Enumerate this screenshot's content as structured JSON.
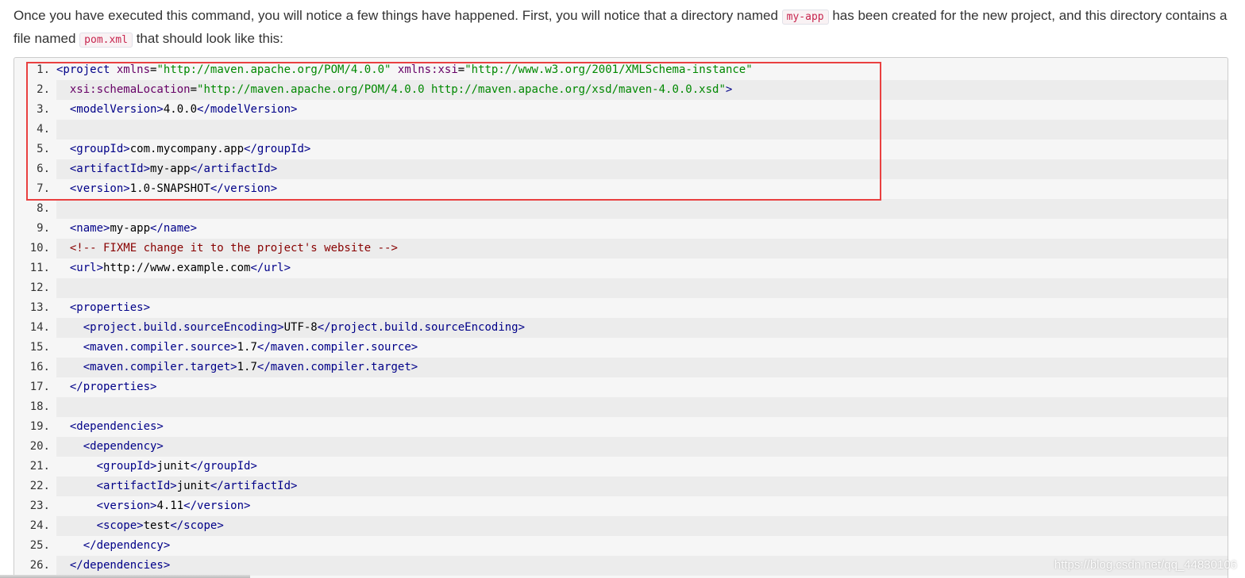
{
  "intro": {
    "part1": "Once you have executed this command, you will notice a few things have happened. First, you will notice that a directory named ",
    "code1": "my-app",
    "part2": " has been created for the new project, and this directory contains a file named ",
    "code2": "pom.xml",
    "part3": " that should look like this:"
  },
  "code": {
    "lines": [
      {
        "n": "1.",
        "tokens": [
          [
            "tag",
            "<project"
          ],
          [
            "pln",
            " "
          ],
          [
            "attr",
            "xmlns"
          ],
          [
            "pln",
            "="
          ],
          [
            "str",
            "\"http://maven.apache.org/POM/4.0.0\""
          ],
          [
            "pln",
            " "
          ],
          [
            "attr",
            "xmlns:xsi"
          ],
          [
            "pln",
            "="
          ],
          [
            "str",
            "\"http://www.w3.org/2001/XMLSchema-instance\""
          ]
        ]
      },
      {
        "n": "2.",
        "tokens": [
          [
            "pln",
            "  "
          ],
          [
            "attr",
            "xsi:schemaLocation"
          ],
          [
            "pln",
            "="
          ],
          [
            "str",
            "\"http://maven.apache.org/POM/4.0.0 http://maven.apache.org/xsd/maven-4.0.0.xsd\""
          ],
          [
            "tag",
            ">"
          ]
        ]
      },
      {
        "n": "3.",
        "tokens": [
          [
            "pln",
            "  "
          ],
          [
            "tag",
            "<modelVersion>"
          ],
          [
            "pln",
            "4.0.0"
          ],
          [
            "tag",
            "</modelVersion>"
          ]
        ]
      },
      {
        "n": "4.",
        "tokens": []
      },
      {
        "n": "5.",
        "tokens": [
          [
            "pln",
            "  "
          ],
          [
            "tag",
            "<groupId>"
          ],
          [
            "pln",
            "com.mycompany.app"
          ],
          [
            "tag",
            "</groupId>"
          ]
        ]
      },
      {
        "n": "6.",
        "tokens": [
          [
            "pln",
            "  "
          ],
          [
            "tag",
            "<artifactId>"
          ],
          [
            "pln",
            "my-app"
          ],
          [
            "tag",
            "</artifactId>"
          ]
        ]
      },
      {
        "n": "7.",
        "tokens": [
          [
            "pln",
            "  "
          ],
          [
            "tag",
            "<version>"
          ],
          [
            "pln",
            "1.0-SNAPSHOT"
          ],
          [
            "tag",
            "</version>"
          ]
        ]
      },
      {
        "n": "8.",
        "tokens": []
      },
      {
        "n": "9.",
        "tokens": [
          [
            "pln",
            "  "
          ],
          [
            "tag",
            "<name>"
          ],
          [
            "pln",
            "my-app"
          ],
          [
            "tag",
            "</name>"
          ]
        ]
      },
      {
        "n": "10.",
        "tokens": [
          [
            "pln",
            "  "
          ],
          [
            "com",
            "<!-- FIXME change it to the project's website -->"
          ]
        ]
      },
      {
        "n": "11.",
        "tokens": [
          [
            "pln",
            "  "
          ],
          [
            "tag",
            "<url>"
          ],
          [
            "pln",
            "http://www.example.com"
          ],
          [
            "tag",
            "</url>"
          ]
        ]
      },
      {
        "n": "12.",
        "tokens": []
      },
      {
        "n": "13.",
        "tokens": [
          [
            "pln",
            "  "
          ],
          [
            "tag",
            "<properties>"
          ]
        ]
      },
      {
        "n": "14.",
        "tokens": [
          [
            "pln",
            "    "
          ],
          [
            "tag",
            "<project.build.sourceEncoding>"
          ],
          [
            "pln",
            "UTF-8"
          ],
          [
            "tag",
            "</project.build.sourceEncoding>"
          ]
        ]
      },
      {
        "n": "15.",
        "tokens": [
          [
            "pln",
            "    "
          ],
          [
            "tag",
            "<maven.compiler.source>"
          ],
          [
            "pln",
            "1.7"
          ],
          [
            "tag",
            "</maven.compiler.source>"
          ]
        ]
      },
      {
        "n": "16.",
        "tokens": [
          [
            "pln",
            "    "
          ],
          [
            "tag",
            "<maven.compiler.target>"
          ],
          [
            "pln",
            "1.7"
          ],
          [
            "tag",
            "</maven.compiler.target>"
          ]
        ]
      },
      {
        "n": "17.",
        "tokens": [
          [
            "pln",
            "  "
          ],
          [
            "tag",
            "</properties>"
          ]
        ]
      },
      {
        "n": "18.",
        "tokens": []
      },
      {
        "n": "19.",
        "tokens": [
          [
            "pln",
            "  "
          ],
          [
            "tag",
            "<dependencies>"
          ]
        ]
      },
      {
        "n": "20.",
        "tokens": [
          [
            "pln",
            "    "
          ],
          [
            "tag",
            "<dependency>"
          ]
        ]
      },
      {
        "n": "21.",
        "tokens": [
          [
            "pln",
            "      "
          ],
          [
            "tag",
            "<groupId>"
          ],
          [
            "pln",
            "junit"
          ],
          [
            "tag",
            "</groupId>"
          ]
        ]
      },
      {
        "n": "22.",
        "tokens": [
          [
            "pln",
            "      "
          ],
          [
            "tag",
            "<artifactId>"
          ],
          [
            "pln",
            "junit"
          ],
          [
            "tag",
            "</artifactId>"
          ]
        ]
      },
      {
        "n": "23.",
        "tokens": [
          [
            "pln",
            "      "
          ],
          [
            "tag",
            "<version>"
          ],
          [
            "pln",
            "4.11"
          ],
          [
            "tag",
            "</version>"
          ]
        ]
      },
      {
        "n": "24.",
        "tokens": [
          [
            "pln",
            "      "
          ],
          [
            "tag",
            "<scope>"
          ],
          [
            "pln",
            "test"
          ],
          [
            "tag",
            "</scope>"
          ]
        ]
      },
      {
        "n": "25.",
        "tokens": [
          [
            "pln",
            "    "
          ],
          [
            "tag",
            "</dependency>"
          ]
        ]
      },
      {
        "n": "26.",
        "tokens": [
          [
            "pln",
            "  "
          ],
          [
            "tag",
            "</dependencies>"
          ]
        ]
      }
    ]
  },
  "watermark": "https://blog.csdn.net/qq_44830106",
  "colors": {
    "highlight_border": "#e94040",
    "inline_code_text": "#c7254e",
    "tag": "#000088",
    "attr": "#660066",
    "string": "#008800",
    "comment": "#880000"
  }
}
